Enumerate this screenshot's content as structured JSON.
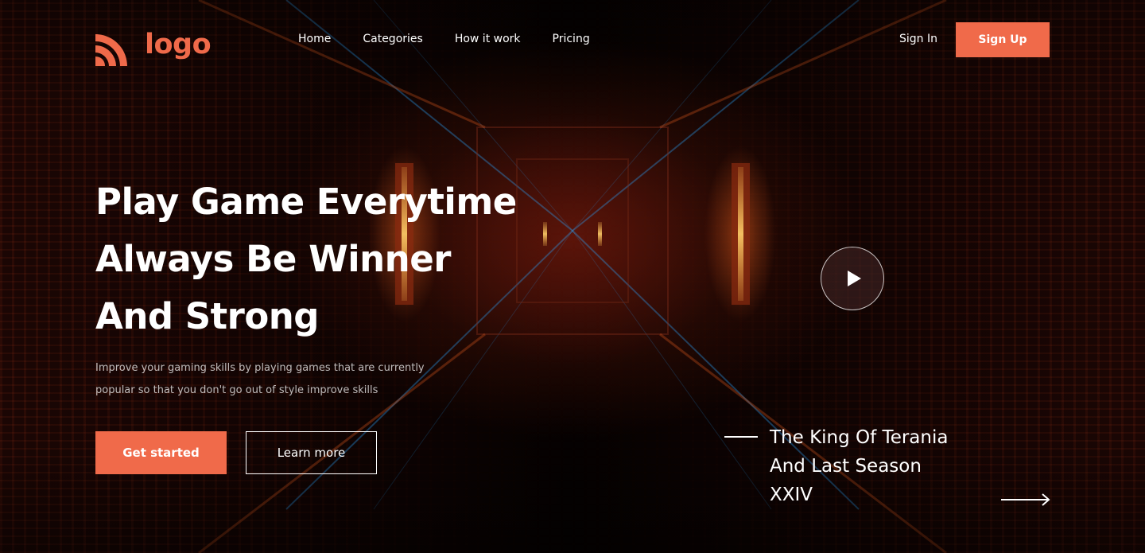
{
  "brand": {
    "name": "logo",
    "accent": "#f06a4a",
    "logo_icon": "wifi-signal-logo-icon"
  },
  "nav": {
    "items": [
      {
        "label": "Home"
      },
      {
        "label": "Categories"
      },
      {
        "label": "How it work"
      },
      {
        "label": "Pricing"
      }
    ]
  },
  "auth": {
    "signin_label": "Sign In",
    "signup_label": "Sign Up"
  },
  "hero": {
    "title_lines": [
      "Play Game Everytime",
      "Always Be Winner",
      "And Strong"
    ],
    "subtitle_lines": [
      "Improve your gaming skills by playing games that are currently",
      "popular so that you don't go out of style improve skills"
    ],
    "primary_cta": "Get started",
    "secondary_cta": "Learn more"
  },
  "video": {
    "icon": "play-icon"
  },
  "featured": {
    "title_lines": [
      "The King Of Terania",
      "And Last Season",
      "XXIV"
    ],
    "arrow_icon": "arrow-right-icon"
  }
}
